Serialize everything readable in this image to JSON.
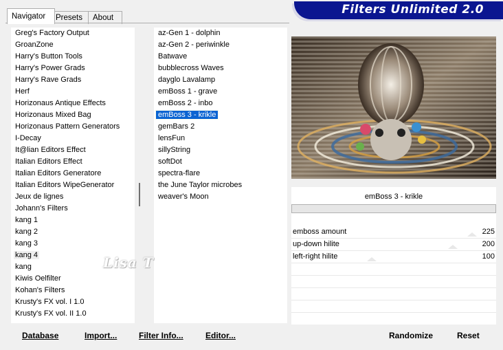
{
  "banner": {
    "title": "Filters Unlimited 2.0"
  },
  "tabs": [
    {
      "label": "Navigator"
    },
    {
      "label": "Presets"
    },
    {
      "label": "About"
    }
  ],
  "categories": [
    "Greg's Factory Output",
    "GroanZone",
    "Harry's Button Tools",
    "Harry's Power Grads",
    "Harry's Rave Grads",
    "Herf",
    "Horizonaus Antique Effects",
    "Horizonaus Mixed Bag",
    "Horizonaus Pattern Generators",
    "I-Decay",
    "It@lian Editors Effect",
    "Italian Editors Effect",
    "Italian Editors Generatore",
    "Italian Editors WipeGenerator",
    "Jeux de lignes",
    "Johann's Filters",
    "kang 1",
    "kang 2",
    "kang 3",
    "kang 4",
    "kang",
    "Kiwis Oelfilter",
    "Kohan's Filters",
    "Krusty's FX vol. I 1.0",
    "Krusty's FX vol. II 1.0"
  ],
  "filters": [
    "az-Gen 1  -  dolphin",
    "az-Gen 2  -  periwinkle",
    "Batwave",
    "bubblecross Waves",
    "dayglo Lavalamp",
    "emBoss 1  -  grave",
    "emBoss 2  -  inbo",
    "emBoss 3  -  krikle",
    "gemBars 2",
    "lensFun",
    "sillyString",
    "softDot",
    "spectra-flare",
    "the June Taylor microbes",
    "weaver's Moon"
  ],
  "selected_filter_index": 7,
  "highlighted_category_index": 19,
  "watermark": "Lisa T",
  "current_filter": "emBoss 3  -  krikle",
  "parameters": [
    {
      "label": "emboss amount",
      "value": "225"
    },
    {
      "label": "up-down hilite",
      "value": "200"
    },
    {
      "label": "left-right hilite",
      "value": "100"
    }
  ],
  "buttons": {
    "database": "Database",
    "import": "Import...",
    "filter_info": "Filter Info...",
    "editor": "Editor...",
    "randomize": "Randomize",
    "reset": "Reset"
  }
}
